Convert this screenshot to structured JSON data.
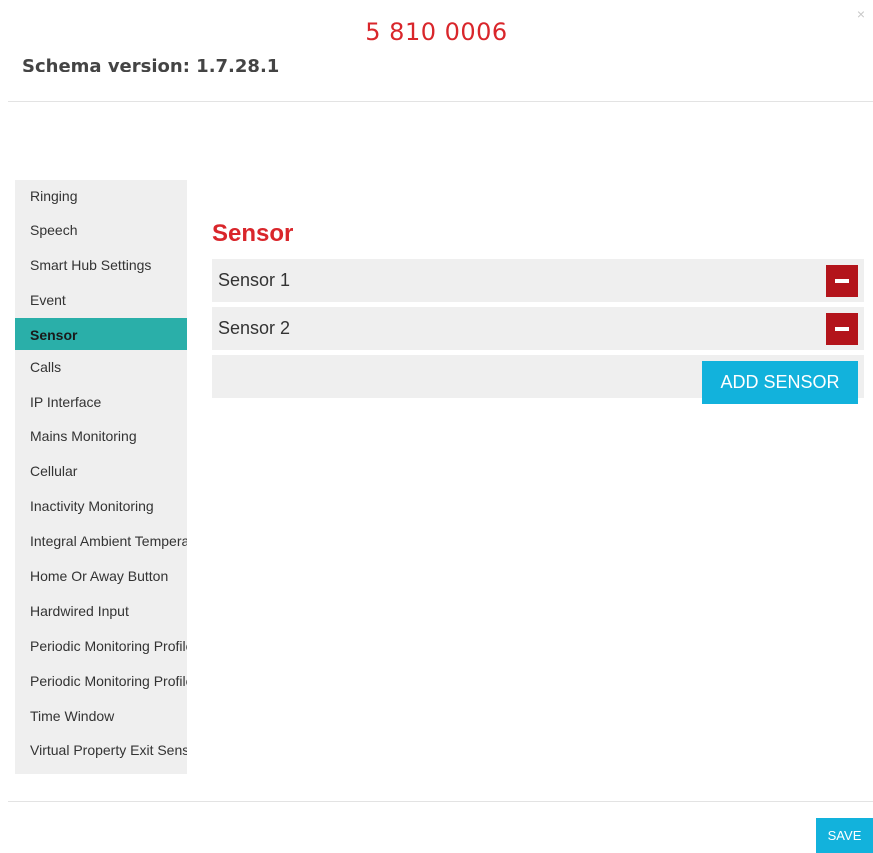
{
  "header": {
    "title": "5 810 0006",
    "close_glyph": "×",
    "schema_version": "Schema version: 1.7.28.1"
  },
  "sidebar": {
    "items": [
      {
        "label": "Ringing"
      },
      {
        "label": "Speech"
      },
      {
        "label": "Smart Hub Settings"
      },
      {
        "label": "Event"
      },
      {
        "label": "Sensor",
        "active": true
      },
      {
        "label": "Calls"
      },
      {
        "label": "IP Interface"
      },
      {
        "label": "Mains Monitoring"
      },
      {
        "label": "Cellular"
      },
      {
        "label": "Inactivity Monitoring"
      },
      {
        "label": "Integral Ambient Temperature"
      },
      {
        "label": "Home Or Away Button"
      },
      {
        "label": "Hardwired Input"
      },
      {
        "label": "Periodic Monitoring Profile"
      },
      {
        "label": "Periodic Monitoring Profile"
      },
      {
        "label": "Time Window"
      },
      {
        "label": "Virtual Property Exit Sensor"
      }
    ]
  },
  "main": {
    "section_title": "Sensor",
    "sensors": [
      {
        "label": "Sensor 1"
      },
      {
        "label": "Sensor 2"
      }
    ],
    "add_button_label": "ADD SENSOR"
  },
  "footer": {
    "save_label": "SAVE"
  },
  "colors": {
    "title_red": "#d9262b",
    "active_teal": "#2aafa9",
    "remove_red": "#b3141b",
    "button_blue": "#12b2dc"
  },
  "icons": {
    "close": "close-icon",
    "remove": "minus-icon"
  }
}
